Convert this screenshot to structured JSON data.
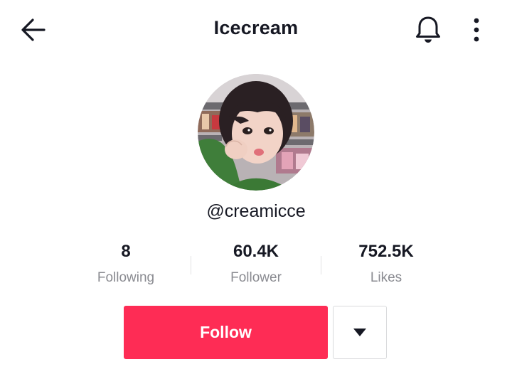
{
  "header": {
    "title": "Icecream",
    "back_icon": "arrow-left-icon",
    "notification_icon": "bell-icon",
    "more_icon": "more-vertical-icon"
  },
  "profile": {
    "avatar": "profile-photo",
    "username": "@creamicce"
  },
  "stats": {
    "following": {
      "value": "8",
      "label": "Following"
    },
    "followers": {
      "value": "60.4K",
      "label": "Follower"
    },
    "likes": {
      "value": "752.5K",
      "label": "Likes"
    }
  },
  "actions": {
    "follow_label": "Follow",
    "dropdown_icon": "caret-down-icon"
  },
  "colors": {
    "accent": "#fe2c55",
    "text_primary": "#161823",
    "text_secondary": "#8a8b91"
  }
}
